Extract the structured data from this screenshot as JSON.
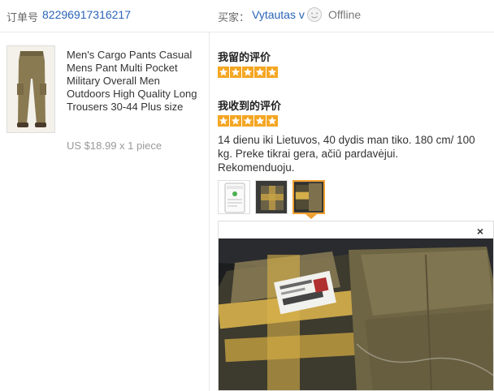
{
  "header": {
    "order_label": "订单号",
    "order_number": "82296917316217",
    "buyer_label": "买家：",
    "buyer_name": "Vytautas v",
    "status": "Offline"
  },
  "product": {
    "title": "Men's Cargo Pants Casual Mens Pant Multi Pocket Military Overall Men Outdoors High Quality Long Trousers 30-44 Plus size",
    "price": "US $18.99 x 1 piece"
  },
  "feedback_given": {
    "title": "我留的评价",
    "rating": 5
  },
  "feedback_received": {
    "title": "我收到的评价",
    "rating": 5,
    "text": "14 dienu iki Lietuvos, 40 dydis man tiko. 180 cm/ 100 kg. Preke tikrai gera, ačiū pardavėjui. Rekomenduoju."
  },
  "preview": {
    "close_label": "×"
  },
  "colors": {
    "link": "#2a63b8",
    "star": "#f5a623",
    "active_border": "#f0a030"
  }
}
